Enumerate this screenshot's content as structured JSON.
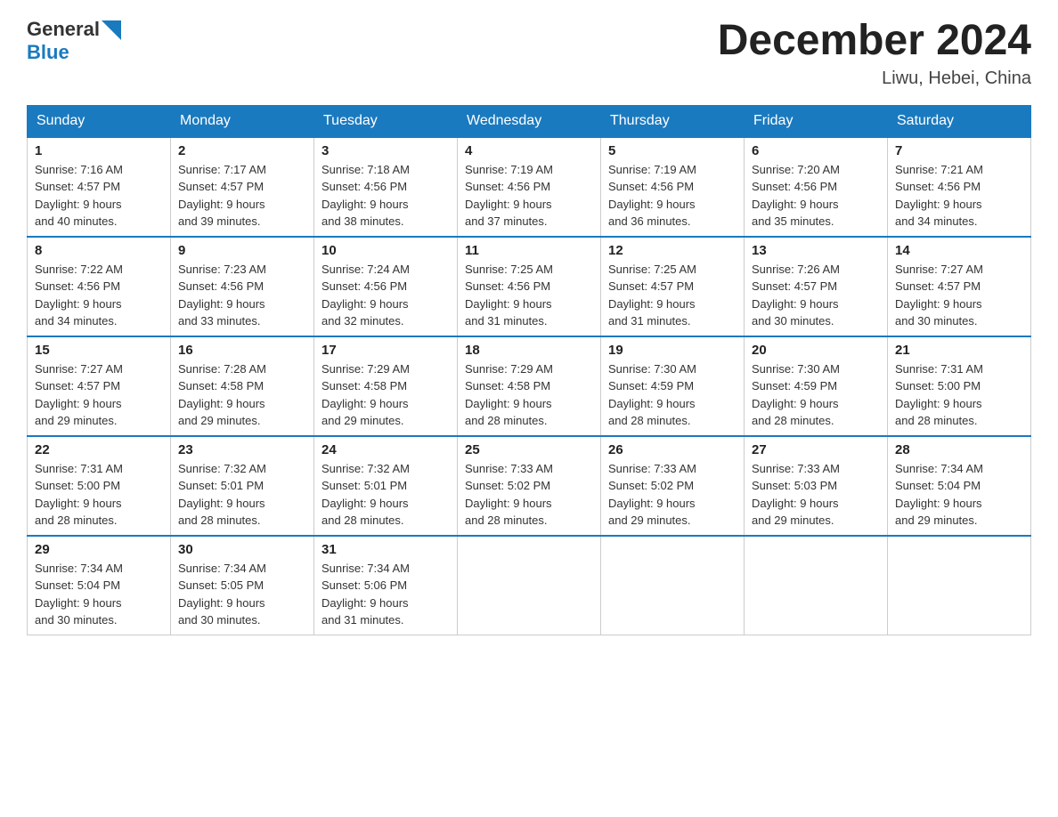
{
  "header": {
    "logo_general": "General",
    "logo_blue": "Blue",
    "month_title": "December 2024",
    "location": "Liwu, Hebei, China"
  },
  "weekdays": [
    "Sunday",
    "Monday",
    "Tuesday",
    "Wednesday",
    "Thursday",
    "Friday",
    "Saturday"
  ],
  "weeks": [
    [
      {
        "day": "1",
        "sunrise": "7:16 AM",
        "sunset": "4:57 PM",
        "daylight": "9 hours and 40 minutes."
      },
      {
        "day": "2",
        "sunrise": "7:17 AM",
        "sunset": "4:57 PM",
        "daylight": "9 hours and 39 minutes."
      },
      {
        "day": "3",
        "sunrise": "7:18 AM",
        "sunset": "4:56 PM",
        "daylight": "9 hours and 38 minutes."
      },
      {
        "day": "4",
        "sunrise": "7:19 AM",
        "sunset": "4:56 PM",
        "daylight": "9 hours and 37 minutes."
      },
      {
        "day": "5",
        "sunrise": "7:19 AM",
        "sunset": "4:56 PM",
        "daylight": "9 hours and 36 minutes."
      },
      {
        "day": "6",
        "sunrise": "7:20 AM",
        "sunset": "4:56 PM",
        "daylight": "9 hours and 35 minutes."
      },
      {
        "day": "7",
        "sunrise": "7:21 AM",
        "sunset": "4:56 PM",
        "daylight": "9 hours and 34 minutes."
      }
    ],
    [
      {
        "day": "8",
        "sunrise": "7:22 AM",
        "sunset": "4:56 PM",
        "daylight": "9 hours and 34 minutes."
      },
      {
        "day": "9",
        "sunrise": "7:23 AM",
        "sunset": "4:56 PM",
        "daylight": "9 hours and 33 minutes."
      },
      {
        "day": "10",
        "sunrise": "7:24 AM",
        "sunset": "4:56 PM",
        "daylight": "9 hours and 32 minutes."
      },
      {
        "day": "11",
        "sunrise": "7:25 AM",
        "sunset": "4:56 PM",
        "daylight": "9 hours and 31 minutes."
      },
      {
        "day": "12",
        "sunrise": "7:25 AM",
        "sunset": "4:57 PM",
        "daylight": "9 hours and 31 minutes."
      },
      {
        "day": "13",
        "sunrise": "7:26 AM",
        "sunset": "4:57 PM",
        "daylight": "9 hours and 30 minutes."
      },
      {
        "day": "14",
        "sunrise": "7:27 AM",
        "sunset": "4:57 PM",
        "daylight": "9 hours and 30 minutes."
      }
    ],
    [
      {
        "day": "15",
        "sunrise": "7:27 AM",
        "sunset": "4:57 PM",
        "daylight": "9 hours and 29 minutes."
      },
      {
        "day": "16",
        "sunrise": "7:28 AM",
        "sunset": "4:58 PM",
        "daylight": "9 hours and 29 minutes."
      },
      {
        "day": "17",
        "sunrise": "7:29 AM",
        "sunset": "4:58 PM",
        "daylight": "9 hours and 29 minutes."
      },
      {
        "day": "18",
        "sunrise": "7:29 AM",
        "sunset": "4:58 PM",
        "daylight": "9 hours and 28 minutes."
      },
      {
        "day": "19",
        "sunrise": "7:30 AM",
        "sunset": "4:59 PM",
        "daylight": "9 hours and 28 minutes."
      },
      {
        "day": "20",
        "sunrise": "7:30 AM",
        "sunset": "4:59 PM",
        "daylight": "9 hours and 28 minutes."
      },
      {
        "day": "21",
        "sunrise": "7:31 AM",
        "sunset": "5:00 PM",
        "daylight": "9 hours and 28 minutes."
      }
    ],
    [
      {
        "day": "22",
        "sunrise": "7:31 AM",
        "sunset": "5:00 PM",
        "daylight": "9 hours and 28 minutes."
      },
      {
        "day": "23",
        "sunrise": "7:32 AM",
        "sunset": "5:01 PM",
        "daylight": "9 hours and 28 minutes."
      },
      {
        "day": "24",
        "sunrise": "7:32 AM",
        "sunset": "5:01 PM",
        "daylight": "9 hours and 28 minutes."
      },
      {
        "day": "25",
        "sunrise": "7:33 AM",
        "sunset": "5:02 PM",
        "daylight": "9 hours and 28 minutes."
      },
      {
        "day": "26",
        "sunrise": "7:33 AM",
        "sunset": "5:02 PM",
        "daylight": "9 hours and 29 minutes."
      },
      {
        "day": "27",
        "sunrise": "7:33 AM",
        "sunset": "5:03 PM",
        "daylight": "9 hours and 29 minutes."
      },
      {
        "day": "28",
        "sunrise": "7:34 AM",
        "sunset": "5:04 PM",
        "daylight": "9 hours and 29 minutes."
      }
    ],
    [
      {
        "day": "29",
        "sunrise": "7:34 AM",
        "sunset": "5:04 PM",
        "daylight": "9 hours and 30 minutes."
      },
      {
        "day": "30",
        "sunrise": "7:34 AM",
        "sunset": "5:05 PM",
        "daylight": "9 hours and 30 minutes."
      },
      {
        "day": "31",
        "sunrise": "7:34 AM",
        "sunset": "5:06 PM",
        "daylight": "9 hours and 31 minutes."
      },
      null,
      null,
      null,
      null
    ]
  ],
  "labels": {
    "sunrise": "Sunrise:",
    "sunset": "Sunset:",
    "daylight": "Daylight:"
  }
}
